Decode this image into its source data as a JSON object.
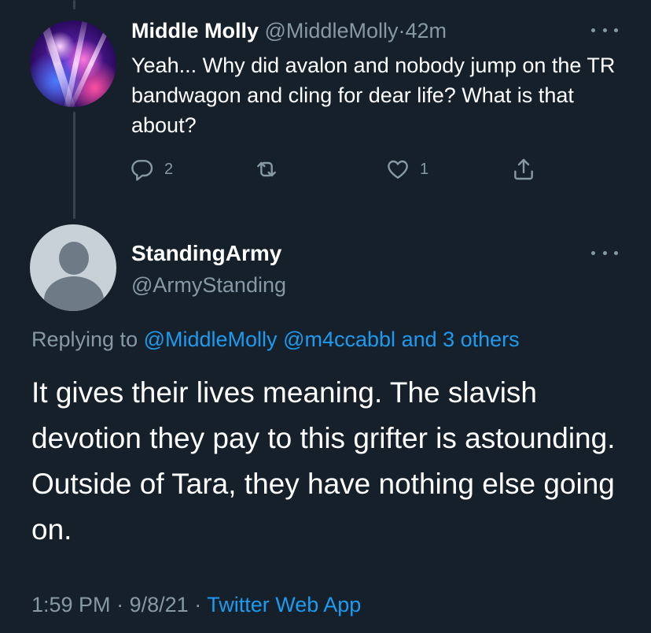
{
  "reply_tweet": {
    "author_name": "Middle Molly",
    "author_handle": "@MiddleMolly",
    "time_ago": "42m",
    "text": "Yeah... Why did avalon and nobody jump on the TR bandwagon and cling for dear life? What is that about?",
    "reply_count": "2",
    "retweet_count": "",
    "like_count": "1"
  },
  "main_tweet": {
    "author_name": "StandingArmy",
    "author_handle": "@ArmyStanding",
    "replying_prefix": "Replying to",
    "replying_to": [
      "@MiddleMolly",
      "@m4ccabbl"
    ],
    "replying_others": "and 3 others",
    "text": "It gives their lives meaning. The slavish devotion they pay to this grifter is astounding. Outside of Tara, they have nothing else going on.",
    "time": "1:59 PM",
    "date": "9/8/21",
    "source": "Twitter Web App"
  },
  "separator": "·",
  "colors": {
    "background": "#15202b",
    "text_primary": "#ffffff",
    "text_secondary": "#8899a6",
    "link": "#1d9bf0",
    "thread_line": "#38444d"
  },
  "icons": [
    "reply-icon",
    "retweet-icon",
    "like-icon",
    "share-icon",
    "more-icon"
  ]
}
